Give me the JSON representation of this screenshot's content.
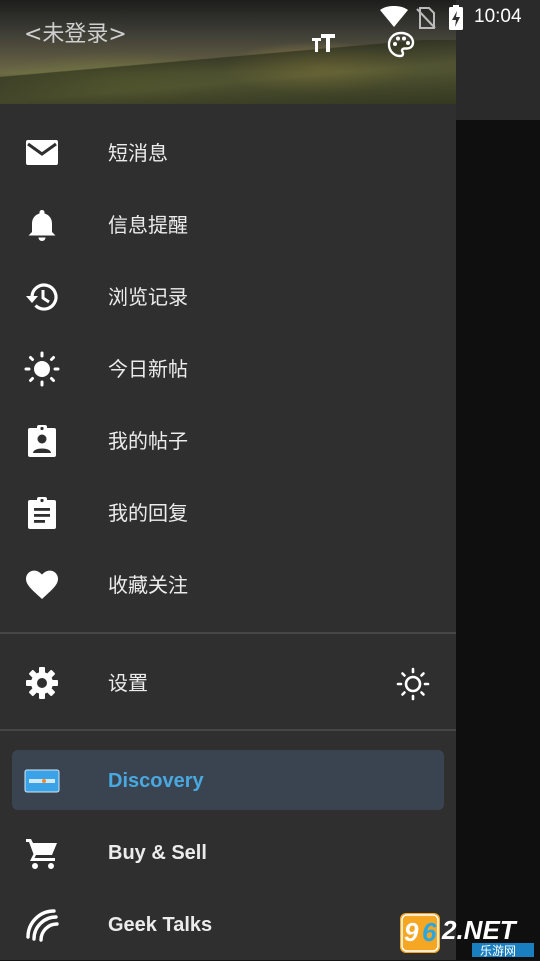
{
  "status_bar": {
    "time": "10:04"
  },
  "header": {
    "login_text": "<未登录>"
  },
  "menu": {
    "items": [
      {
        "label": "短消息",
        "icon": "mail-icon"
      },
      {
        "label": "信息提醒",
        "icon": "bell-icon"
      },
      {
        "label": "浏览记录",
        "icon": "history-icon"
      },
      {
        "label": "今日新帖",
        "icon": "sun-icon"
      },
      {
        "label": "我的帖子",
        "icon": "assignment-ind-icon"
      },
      {
        "label": "我的回复",
        "icon": "assignment-icon"
      },
      {
        "label": "收藏关注",
        "icon": "heart-icon"
      }
    ],
    "settings": {
      "label": "设置",
      "icon": "gear-icon",
      "theme_icon": "brightness-icon"
    },
    "forums": [
      {
        "label": "Discovery",
        "icon": "discover-card-icon",
        "active": true
      },
      {
        "label": "Buy & Sell",
        "icon": "cart-icon"
      },
      {
        "label": "Geek Talks",
        "icon": "geek-talks-icon"
      }
    ]
  },
  "watermark": {
    "brand": "962.NET",
    "sub": "乐游网"
  },
  "colors": {
    "accent": "#4aa8e0",
    "drawer_bg": "#2f2f2f",
    "active_bg": "#3a4450"
  }
}
